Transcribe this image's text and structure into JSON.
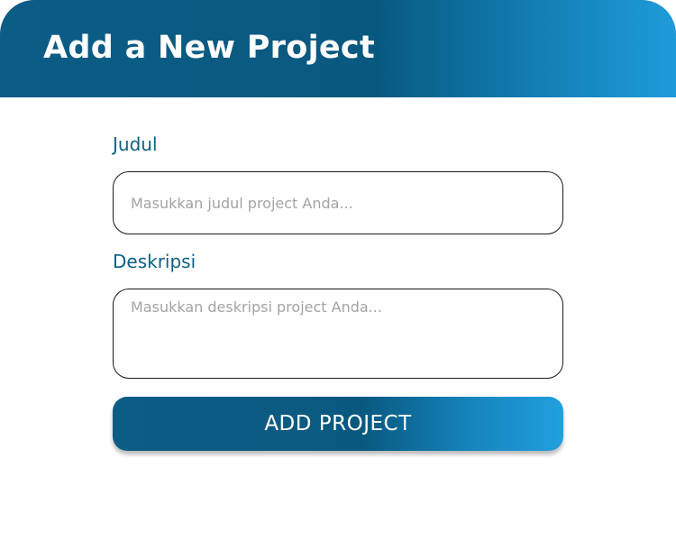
{
  "header": {
    "title": "Add a New Project"
  },
  "form": {
    "title_field": {
      "label": "Judul",
      "placeholder": "Masukkan judul project Anda...",
      "value": ""
    },
    "description_field": {
      "label": "Deskripsi",
      "placeholder": "Masukkan deskripsi project Anda...",
      "value": ""
    },
    "submit_label": "ADD PROJECT"
  },
  "colors": {
    "accent_dark": "#0b5d86",
    "accent_light": "#1f9bda",
    "label_color": "#0b5f86",
    "placeholder_color": "#a3a3a3"
  }
}
